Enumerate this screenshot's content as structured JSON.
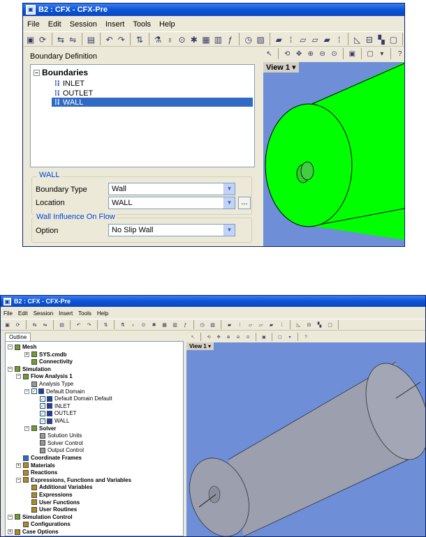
{
  "top": {
    "title": "B2 : CFX - CFX-Pre",
    "menu": [
      "File",
      "Edit",
      "Session",
      "Insert",
      "Tools",
      "Help"
    ],
    "panel_title": "Boundary Definition",
    "tree": {
      "root": "Boundaries",
      "items": [
        "INLET",
        "OUTLET",
        "WALL"
      ]
    },
    "view_label": "View 1",
    "group_title": "WALL",
    "boundary_type_label": "Boundary Type",
    "boundary_type_value": "Wall",
    "location_label": "Location",
    "location_value": "WALL",
    "ellipsis": "...",
    "influence_group_title": "Wall Influence On Flow",
    "option_label": "Option",
    "option_value": "No Slip Wall"
  },
  "bottom": {
    "title": "B2 : CFX - CFX-Pre",
    "menu": [
      "File",
      "Edit",
      "Session",
      "Insert",
      "Tools",
      "Help"
    ],
    "outline_tab": "Outline",
    "view_label": "View 1",
    "tree": [
      {
        "label": "Mesh",
        "bold": true
      },
      {
        "label": "SYS.cmdb",
        "bold": true
      },
      {
        "label": "Connectivity",
        "bold": true
      },
      {
        "label": "Simulation",
        "bold": true
      },
      {
        "label": "Flow Analysis 1",
        "bold": true
      },
      {
        "label": "Analysis Type",
        "bold": false
      },
      {
        "label": "Default Domain",
        "bold": false
      },
      {
        "label": "Default Domain Default",
        "bold": false
      },
      {
        "label": "INLET",
        "bold": false
      },
      {
        "label": "OUTLET",
        "bold": false
      },
      {
        "label": "WALL",
        "bold": false
      },
      {
        "label": "Solver",
        "bold": true
      },
      {
        "label": "Solution Units",
        "bold": false
      },
      {
        "label": "Solver Control",
        "bold": false
      },
      {
        "label": "Output Control",
        "bold": false
      },
      {
        "label": "Coordinate Frames",
        "bold": true
      },
      {
        "label": "Materials",
        "bold": true
      },
      {
        "label": "Reactions",
        "bold": true
      },
      {
        "label": "Expressions, Functions and Variables",
        "bold": true
      },
      {
        "label": "Additional Variables",
        "bold": true
      },
      {
        "label": "Expressions",
        "bold": true
      },
      {
        "label": "User Functions",
        "bold": true
      },
      {
        "label": "User Routines",
        "bold": true
      },
      {
        "label": "Simulation Control",
        "bold": true
      },
      {
        "label": "Configurations",
        "bold": true
      },
      {
        "label": "Case Options",
        "bold": true
      }
    ]
  },
  "colors": {
    "title_blue": "#0b53d6",
    "viewport_blue": "#6e8fd8",
    "cylinder_green": "#00ff00",
    "cylinder_gray": "#9c9fae",
    "selection_blue": "#316ac5",
    "group_title_blue": "#0046d5"
  },
  "icons": [
    "app-icon",
    "boundary-icon",
    "mesh-icon",
    "domain-icon",
    "checkbox-icon",
    "solver-icon",
    "clock-icon",
    "axes-icon",
    "material-icon",
    "expression-icon"
  ]
}
